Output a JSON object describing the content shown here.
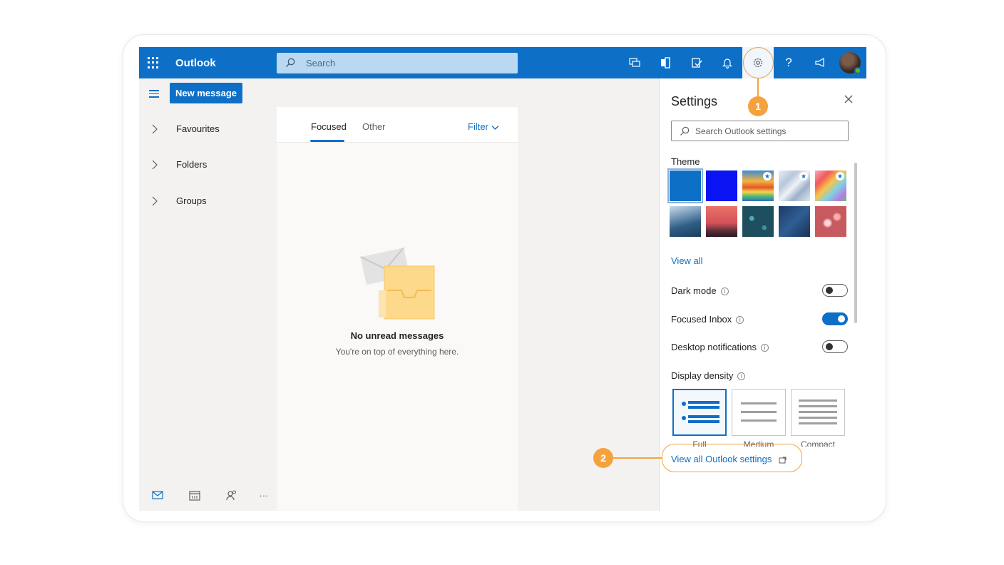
{
  "topbar": {
    "app_name": "Outlook",
    "search_placeholder": "Search",
    "help_glyph": "?",
    "icons": [
      "waffle-icon",
      "search-icon",
      "chat-icon",
      "office-icon",
      "todo-icon",
      "bell-icon",
      "gear-icon",
      "help-icon",
      "feedback-icon",
      "avatar"
    ]
  },
  "leftnav": {
    "new_message": "New message",
    "items": [
      {
        "label": "Favourites"
      },
      {
        "label": "Folders"
      },
      {
        "label": "Groups"
      }
    ],
    "more_glyph": "···"
  },
  "messagelist": {
    "tabs": [
      {
        "label": "Focused",
        "active": true
      },
      {
        "label": "Other",
        "active": false
      }
    ],
    "filter_label": "Filter",
    "empty_title": "No unread messages",
    "empty_subtitle": "You're on top of everything here."
  },
  "settings": {
    "title": "Settings",
    "search_placeholder": "Search Outlook settings",
    "theme_heading": "Theme",
    "view_all": "View all",
    "toggles": [
      {
        "label": "Dark mode",
        "on": false
      },
      {
        "label": "Focused Inbox",
        "on": true
      },
      {
        "label": "Desktop notifications",
        "on": false
      }
    ],
    "display_density_heading": "Display density",
    "density_options": [
      "Full",
      "Medium",
      "Compact"
    ],
    "view_all_outlook_settings": "View all Outlook settings"
  },
  "annotations": {
    "step1": "1",
    "step2": "2",
    "accent_color": "#f5a23d"
  },
  "colors": {
    "brand_blue": "#0e6fc7"
  }
}
